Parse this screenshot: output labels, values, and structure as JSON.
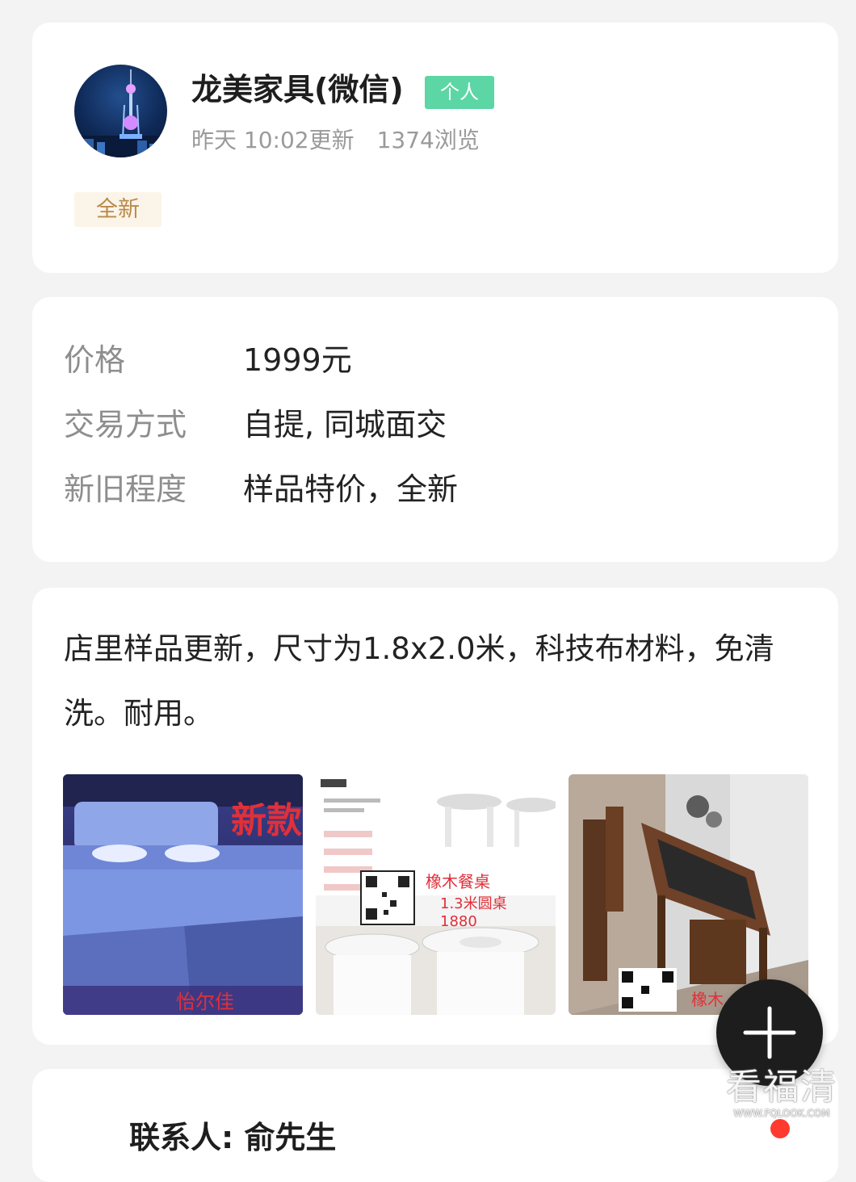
{
  "seller": {
    "name": "龙美家具(微信)",
    "type_badge": "个人",
    "updated": "昨天 10:02更新",
    "views": "1374浏览",
    "condition_tag": "全新",
    "avatar_icon": "tower-night-avatar"
  },
  "attributes": [
    {
      "label": "价格",
      "value": "1999元"
    },
    {
      "label": "交易方式",
      "value": "自提, 同城面交"
    },
    {
      "label": "新旧程度",
      "value": "样品特价，全新"
    }
  ],
  "description": {
    "text": "店里样品更新，尺寸为1.8x2.0米，科技布材料，免清洗。耐用。",
    "photos": [
      {
        "icon": "bed-photo",
        "overlay_top": "新款",
        "overlay_bottom": "怡尔佳"
      },
      {
        "icon": "dining-table-photo",
        "overlay_title": "橡木餐桌",
        "overlay_size": "1.3米圆桌",
        "overlay_price": "1880"
      },
      {
        "icon": "tea-table-photo",
        "overlay_bottom": "橡木"
      }
    ]
  },
  "contact": {
    "label": "联系人: 俞先生"
  },
  "fab": {
    "icon": "plus-icon"
  },
  "watermark": {
    "main": "看福清",
    "url": "WWW.FQLOOK.COM"
  },
  "colors": {
    "page_bg": "#f3f3f3",
    "card_bg": "#ffffff",
    "badge_green": "#5cd6a5",
    "tag_bg": "#fbf4e8",
    "tag_text": "#b98a4a",
    "muted_text": "#9a9a9a",
    "fab_bg": "#1d1d1d",
    "dot_red": "#ff3b30"
  }
}
